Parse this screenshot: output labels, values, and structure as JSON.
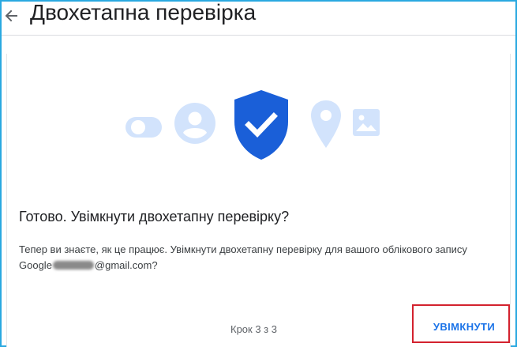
{
  "header": {
    "title": "Двохетапна перевірка",
    "back_icon": "arrow-back-icon"
  },
  "dialog": {
    "title": "Готово. Увімкнути двохетапну перевірку?",
    "body_before": "Тепер ви знаєте, як це працює. Увімкнути двохетапну перевірку для вашого облікового запису Google",
    "body_after": "@gmail.com?",
    "step": "Крок 3 з 3",
    "enable_label": "УВІМКНУТИ"
  },
  "illustration": {
    "icons": [
      "toggle-icon",
      "account-icon",
      "shield-check-icon",
      "location-pin-icon",
      "image-icon"
    ]
  },
  "colors": {
    "accent": "#1a73e8",
    "shield": "#1a5fd8",
    "light_icon": "#d2e3fc",
    "highlight": "#d3222e",
    "frame": "#2aa9e0"
  }
}
